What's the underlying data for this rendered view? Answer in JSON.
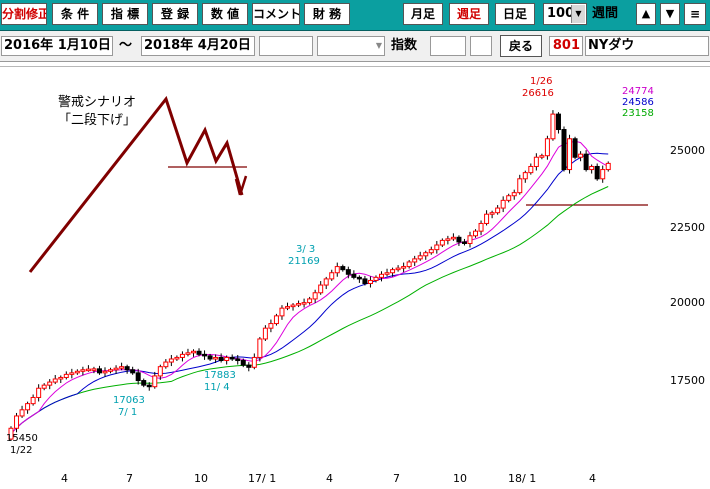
{
  "toolbar": {
    "buttons": {
      "split": "分割修正",
      "conditions": "条 件",
      "indicators": "指 標",
      "register": "登 録",
      "values": "数 値",
      "comment": "コメント",
      "finance": "財 務",
      "monthly": "月足",
      "weekly": "週足",
      "daily": "日足"
    },
    "period_count": "100",
    "period_label": "週間",
    "arrow_up": "▲",
    "arrow_down": "▼",
    "menu": "≡"
  },
  "info": {
    "date_from": "2016年  1月10日",
    "range_sep": "～",
    "date_to": "2018年  4月20日",
    "index_label": "指数",
    "back_label": "戻る",
    "code": "801",
    "name": "NYダウ"
  },
  "annotation": {
    "line1": "警戒シナリオ",
    "line2": "「二段下げ」"
  },
  "chart_data": {
    "type": "candlestick",
    "y_axis": {
      "ticks": [
        "25000",
        "22500",
        "20000",
        "17500"
      ]
    },
    "x_axis": {
      "ticks": [
        "4",
        "7",
        "10",
        "17/ 1",
        "4",
        "7",
        "10",
        "18/ 1",
        "4"
      ]
    },
    "ma_legend": [
      {
        "value": "24774",
        "color": "#cc00cc"
      },
      {
        "value": "24586",
        "color": "#0000cc"
      },
      {
        "value": "23158",
        "color": "#00aa00"
      }
    ],
    "labels": {
      "high_value": "26616",
      "high_date": "1/26",
      "mar_value": "21169",
      "mar_date": "3/ 3",
      "nov_value": "17883",
      "nov_date": "11/ 4",
      "jul_value": "17063",
      "jul_date": "7/ 1",
      "low_value": "15450",
      "low_date": "1/22"
    },
    "closes": [
      15900,
      16300,
      16500,
      16700,
      16900,
      17200,
      17300,
      17400,
      17500,
      17550,
      17650,
      17700,
      17750,
      17800,
      17820,
      17830,
      17700,
      17750,
      17800,
      17850,
      17900,
      17800,
      17700,
      17450,
      17300,
      17250,
      17600,
      17900,
      18050,
      18150,
      18200,
      18300,
      18350,
      18400,
      18300,
      18250,
      18150,
      18200,
      18100,
      18200,
      18150,
      18100,
      17950,
      17880,
      18200,
      18800,
      19150,
      19300,
      19550,
      19800,
      19850,
      19900,
      19950,
      19980,
      20100,
      20300,
      20550,
      20750,
      20950,
      21150,
      21050,
      20900,
      20800,
      20750,
      20600,
      20700,
      20800,
      20900,
      20950,
      21050,
      21100,
      21150,
      21300,
      21400,
      21500,
      21600,
      21700,
      21850,
      22000,
      22050,
      22100,
      21950,
      21900,
      22150,
      22300,
      22550,
      22850,
      22900,
      23050,
      23300,
      23450,
      23550,
      24000,
      24200,
      24400,
      24700,
      24750,
      25300,
      26100,
      25600,
      24300,
      25300,
      24700,
      24800,
      24300,
      24400,
      24000,
      24300,
      24500
    ]
  }
}
